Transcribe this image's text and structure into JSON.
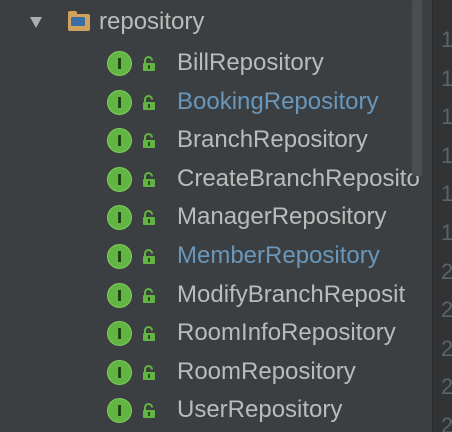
{
  "tree": {
    "folder": {
      "label": "repository",
      "expanded": true,
      "icon": "package-folder-icon"
    },
    "items": [
      {
        "label": "BillRepository",
        "status": "normal"
      },
      {
        "label": "BookingRepository",
        "status": "modified"
      },
      {
        "label": "BranchRepository",
        "status": "normal"
      },
      {
        "label": "CreateBranchReposito",
        "status": "normal"
      },
      {
        "label": "ManagerRepository",
        "status": "normal"
      },
      {
        "label": "MemberRepository",
        "status": "modified"
      },
      {
        "label": "ModifyBranchReposit",
        "status": "normal"
      },
      {
        "label": "RoomInfoRepository",
        "status": "normal"
      },
      {
        "label": "RoomRepository",
        "status": "normal"
      },
      {
        "label": "UserRepository",
        "status": "normal"
      }
    ],
    "item_icon_letter": "I",
    "item_icon": "interface-icon",
    "access_icon": "public-access-icon"
  },
  "gutter": {
    "numbers": [
      "1",
      "1",
      "1",
      "1",
      "1",
      "1",
      "2",
      "2",
      "2",
      "2",
      "2"
    ]
  },
  "colors": {
    "background": "#3c3f41",
    "text": "#bbbbbb",
    "modified_text": "#6897bb",
    "interface_icon": "#62b543",
    "folder_icon": "#d0a25c"
  }
}
